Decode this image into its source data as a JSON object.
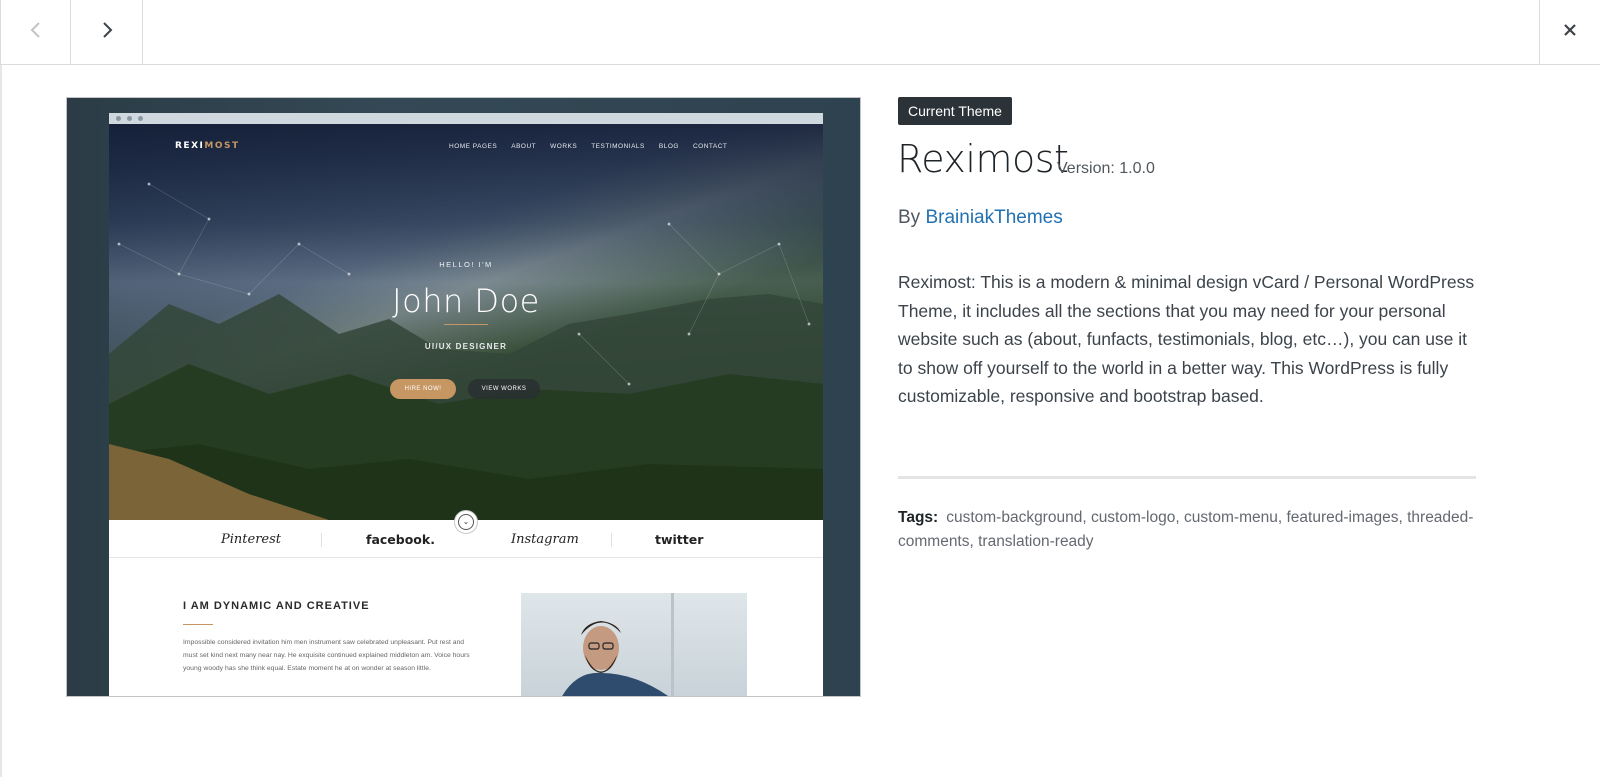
{
  "icons": {
    "prev": "chevron-left-icon",
    "next": "chevron-right-icon",
    "close": "close-icon"
  },
  "preview": {
    "logo_main": "REXI",
    "logo_accent": "MOST",
    "menu": [
      "HOME PAGES",
      "ABOUT",
      "WORKS",
      "TESTIMONIALS",
      "BLOG",
      "CONTACT"
    ],
    "hello": "HELLO! I'M",
    "name": "John Doe",
    "role": "UI/UX DESIGNER",
    "hire_button": "HIRE NOW!",
    "works_button": "VIEW WORKS",
    "brands": [
      "Pinterest",
      "facebook.",
      "Instagram",
      "twitter"
    ],
    "section_title": "I AM DYNAMIC AND CREATIVE",
    "section_text": "Impossible considered invitation him men instrument saw celebrated unpleasant. Put rest and must set kind next many near nay. He exquisite continued explained middleton am. Voice hours young woody has she think equal. Estate moment he at on wonder at season little."
  },
  "theme": {
    "badge": "Current Theme",
    "name": "Reximost",
    "version": "Version: 1.0.0",
    "by_label": "By",
    "author": "BrainiakThemes",
    "description": "Reximost: This is a modern & minimal design vCard / Personal WordPress Theme, it includes all the sections that you may need for your personal website such as (about, funfacts, testimonials, blog, etc…), you can use it to show off yourself to the world in a better way. This WordPress is fully customizable, responsive and bootstrap based.",
    "tags_label": "Tags:",
    "tags": "custom-background, custom-logo, custom-menu, featured-images, threaded-comments, translation-ready"
  },
  "colors": {
    "accent": "#c69663",
    "link": "#2271b1",
    "badge_bg": "#2c3338"
  }
}
